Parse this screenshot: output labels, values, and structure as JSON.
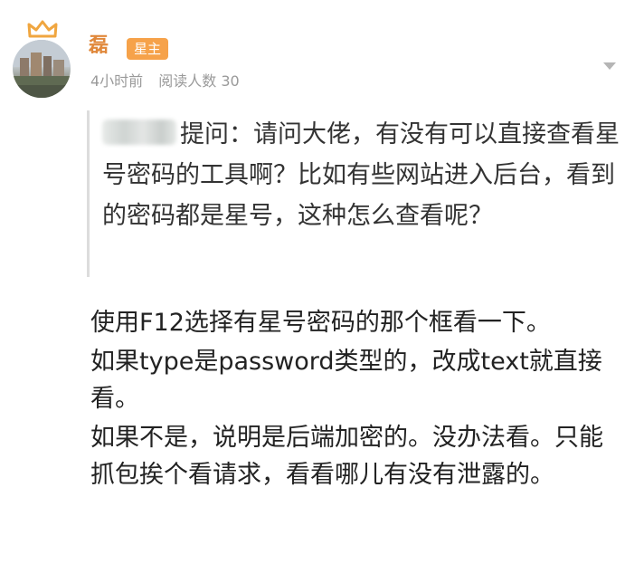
{
  "author": {
    "name": "磊",
    "badge": "星主"
  },
  "meta": {
    "time": "4小时前",
    "reads": "阅读人数 30"
  },
  "question": {
    "text": "提问：请问大佬，有没有可以直接查看星号密码的工具啊？比如有些网站进入后台，看到的密码都是星号，这种怎么查看呢？"
  },
  "answer": {
    "p1": "使用F12选择有星号密码的那个框看一下。",
    "p2": "如果type是password类型的，改成text就直接看。",
    "p3": "如果不是，说明是后端加密的。没办法看。只能抓包挨个看请求，看看哪儿有没有泄露的。"
  },
  "colors": {
    "name": "#e0883b",
    "badge_bg": "#f6a24a",
    "crown": "#f0a640",
    "meta": "#9a9a9a"
  }
}
